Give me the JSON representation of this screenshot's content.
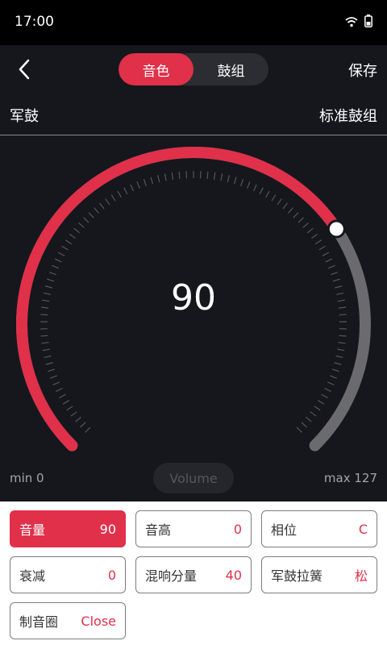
{
  "status": {
    "time": "17:00",
    "icons": [
      "wifi-icon",
      "battery-icon"
    ]
  },
  "header": {
    "tabs": [
      {
        "label": "音色",
        "active": true
      },
      {
        "label": "鼓组",
        "active": false
      }
    ],
    "save_label": "保存"
  },
  "subheader": {
    "instrument": "军鼓",
    "kit": "标准鼓组"
  },
  "dial": {
    "value": "90",
    "min_label": "min 0",
    "max_label": "max 127",
    "mode_label": "Volume",
    "fraction": 0.7087
  },
  "params": [
    {
      "name": "音量",
      "value": "90",
      "active": true
    },
    {
      "name": "音高",
      "value": "0",
      "active": false
    },
    {
      "name": "相位",
      "value": "C",
      "active": false
    },
    {
      "name": "衰减",
      "value": "0",
      "active": false
    },
    {
      "name": "混响分量",
      "value": "40",
      "active": false
    },
    {
      "name": "军鼓拉簧",
      "value": "松",
      "active": false
    },
    {
      "name": "制音圈",
      "value": "Close",
      "active": false
    }
  ],
  "colors": {
    "accent": "#e0304a",
    "track": "#6b6b6f",
    "background": "#16171d"
  }
}
